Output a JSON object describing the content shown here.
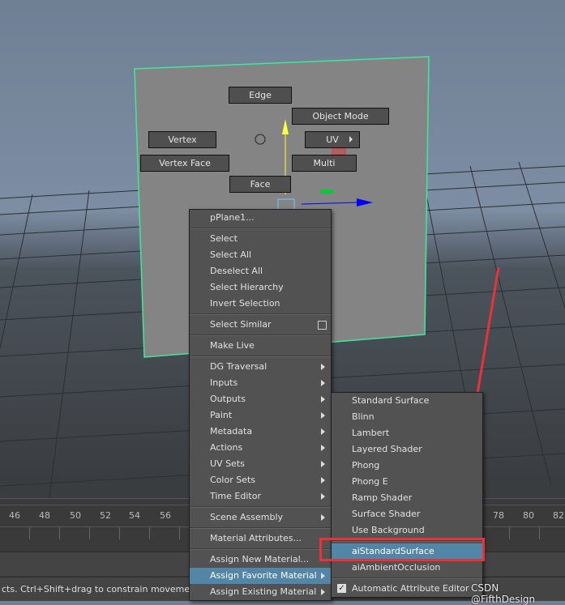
{
  "marking_menu": {
    "edge": "Edge",
    "object_mode": "Object Mode",
    "vertex": "Vertex",
    "uv": "UV",
    "vertex_face": "Vertex Face",
    "multi": "Multi",
    "face": "Face"
  },
  "timeline": {
    "ticks_left": [
      "46",
      "48",
      "50",
      "52",
      "54",
      "56"
    ],
    "ticks_right": [
      "78",
      "80",
      "82"
    ]
  },
  "status_line": "cts. Ctrl+Shift+drag to constrain movement to a conn",
  "context_menu": {
    "title": "pPlane1...",
    "items": [
      {
        "label": "Select"
      },
      {
        "label": "Select All"
      },
      {
        "label": "Deselect All"
      },
      {
        "label": "Select Hierarchy"
      },
      {
        "label": "Invert Selection"
      },
      {
        "label": "Select Similar",
        "option_box": true
      },
      {
        "label": "Make Live"
      },
      {
        "label": "DG Traversal",
        "submenu": true
      },
      {
        "label": "Inputs",
        "submenu": true
      },
      {
        "label": "Outputs",
        "submenu": true
      },
      {
        "label": "Paint",
        "submenu": true
      },
      {
        "label": "Metadata",
        "submenu": true
      },
      {
        "label": "Actions",
        "submenu": true
      },
      {
        "label": "UV Sets",
        "submenu": true
      },
      {
        "label": "Color Sets",
        "submenu": true
      },
      {
        "label": "Time Editor",
        "submenu": true
      },
      {
        "label": "Scene Assembly",
        "submenu": true
      },
      {
        "label": "Material Attributes..."
      },
      {
        "label": "Assign New Material..."
      },
      {
        "label": "Assign Favorite Material",
        "submenu": true,
        "highlighted": true
      },
      {
        "label": "Assign Existing Material",
        "submenu": true
      }
    ]
  },
  "submenu": {
    "items": [
      "Standard Surface",
      "Blinn",
      "Lambert",
      "Layered Shader",
      "Phong",
      "Phong E",
      "Ramp Shader",
      "Surface Shader",
      "Use Background",
      "aiStandardSurface",
      "aiAmbientOcclusion"
    ],
    "highlighted": "aiStandardSurface",
    "checkbox_label": "Automatic Attribute Editor",
    "checkbox_checked": true
  },
  "watermark": "CSDN @FifthDesign",
  "colors": {
    "highlight": "#5285a6",
    "annotation": "#e8333a",
    "selection_outline": "#3fe89a"
  }
}
